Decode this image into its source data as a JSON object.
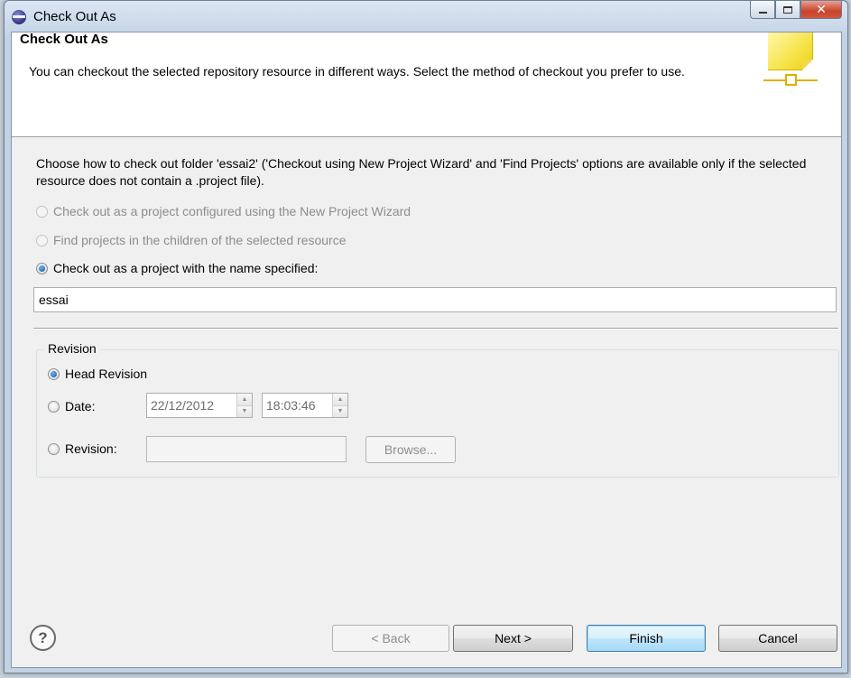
{
  "window": {
    "title": "Check Out As",
    "icon": "eclipse-icon"
  },
  "header": {
    "title": "Check Out As",
    "description": "You can checkout the selected repository resource in different ways. Select the method of checkout you prefer to use.",
    "image_icon": "checkout-wizard-banner-icon"
  },
  "body": {
    "choose_text": "Choose how to check out folder 'essai2' ('Checkout using New Project Wizard' and 'Find Projects' options are available only if the selected resource does not contain a .project file).",
    "options": [
      {
        "label": "Check out as a project configured using the New Project Wizard",
        "selected": false,
        "enabled": false
      },
      {
        "label": "Find projects in the children of the selected resource",
        "selected": false,
        "enabled": false
      },
      {
        "label": "Check out as a project with the name specified:",
        "selected": true,
        "enabled": true
      }
    ],
    "project_name": "essai"
  },
  "revision": {
    "group_label": "Revision",
    "head_label": "Head Revision",
    "date_label": "Date:",
    "date_value": "22/12/2012",
    "time_value": "18:03:46",
    "revision_label": "Revision:",
    "revision_value": "",
    "browse_label": "Browse..."
  },
  "footer": {
    "help_icon": "help-icon",
    "back_label": "< Back",
    "next_label": "Next >",
    "finish_label": "Finish",
    "cancel_label": "Cancel"
  }
}
